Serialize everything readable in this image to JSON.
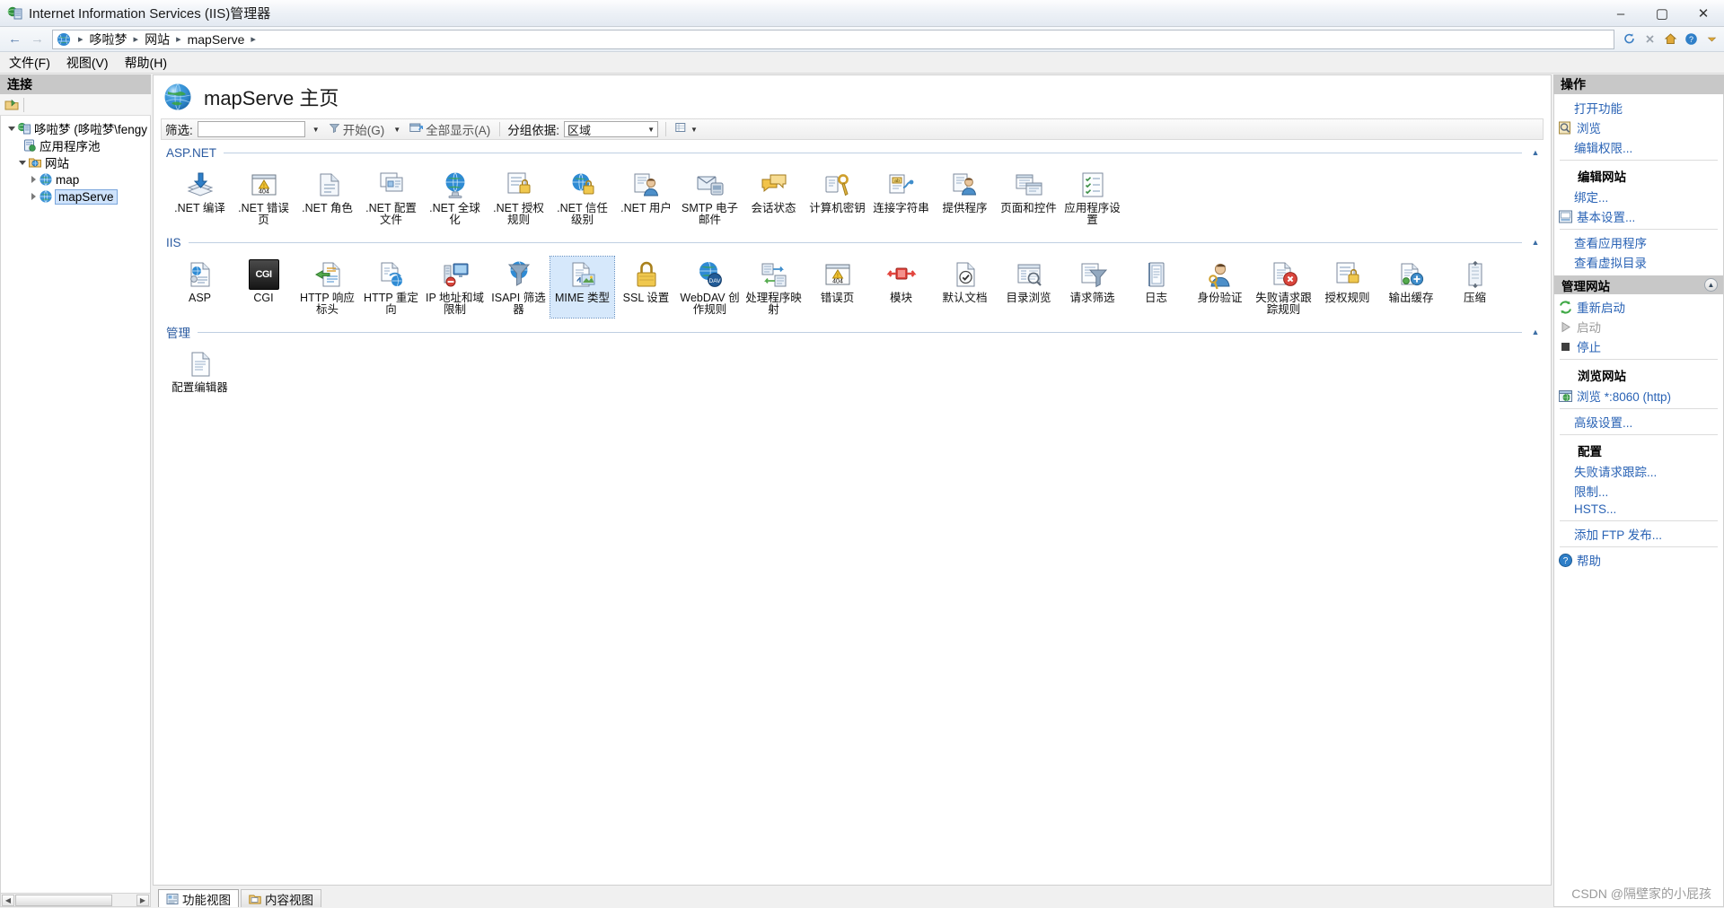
{
  "window": {
    "title": "Internet Information Services (IIS)管理器",
    "minimize": "–",
    "maximize": "▢",
    "close": "✕"
  },
  "address": {
    "back": "←",
    "forward": "→",
    "crumbs": [
      "哆啦梦",
      "网站",
      "mapServe"
    ],
    "separator": "▸",
    "trailing_separator": "▸"
  },
  "menu": {
    "items": [
      "文件(F)",
      "视图(V)",
      "帮助(H)"
    ]
  },
  "connections": {
    "header": "连接",
    "tree": [
      {
        "label": "哆啦梦 (哆啦梦\\fengy",
        "icon": "server-icon",
        "depth": 0,
        "expander": "expanded",
        "selected": false
      },
      {
        "label": "应用程序池",
        "icon": "app-pool-icon",
        "depth": 1,
        "expander": "none",
        "selected": false
      },
      {
        "label": "网站",
        "icon": "sites-folder-icon",
        "depth": 1,
        "expander": "expanded",
        "selected": false
      },
      {
        "label": "map",
        "icon": "site-globe-icon",
        "depth": 2,
        "expander": "collapsed",
        "selected": false
      },
      {
        "label": "mapServe",
        "icon": "site-globe-icon",
        "depth": 2,
        "expander": "collapsed",
        "selected": true
      }
    ]
  },
  "page": {
    "title": "mapServe 主页",
    "filter": {
      "label": "筛选:",
      "value": "",
      "placeholder": "",
      "go_label": "开始(G)",
      "show_all_label": "全部显示(A)",
      "group_by_label": "分组依据:",
      "group_by_value": "区域"
    },
    "sections": [
      {
        "name": "ASP.NET",
        "items": [
          {
            "label": ".NET 编译",
            "icon": "net-compile-icon"
          },
          {
            "label": ".NET 错误页",
            "icon": "error-404-icon"
          },
          {
            "label": ".NET 角色",
            "icon": "net-roles-icon"
          },
          {
            "label": ".NET 配置文件",
            "icon": "net-profile-icon"
          },
          {
            "label": ".NET 全球化",
            "icon": "globe-icon"
          },
          {
            "label": ".NET 授权规则",
            "icon": "auth-rules-icon"
          },
          {
            "label": ".NET 信任级别",
            "icon": "trust-levels-icon"
          },
          {
            "label": ".NET 用户",
            "icon": "net-users-icon"
          },
          {
            "label": "SMTP 电子邮件",
            "icon": "smtp-email-icon"
          },
          {
            "label": "会话状态",
            "icon": "session-state-icon"
          },
          {
            "label": "计算机密钥",
            "icon": "machine-key-icon"
          },
          {
            "label": "连接字符串",
            "icon": "connection-strings-icon"
          },
          {
            "label": "提供程序",
            "icon": "providers-icon"
          },
          {
            "label": "页面和控件",
            "icon": "pages-controls-icon"
          },
          {
            "label": "应用程序设置",
            "icon": "app-settings-icon"
          }
        ]
      },
      {
        "name": "IIS",
        "items": [
          {
            "label": "ASP",
            "icon": "asp-icon"
          },
          {
            "label": "CGI",
            "icon": "cgi-icon"
          },
          {
            "label": "HTTP 响应标头",
            "icon": "http-response-headers-icon"
          },
          {
            "label": "HTTP 重定向",
            "icon": "http-redirect-icon"
          },
          {
            "label": "IP 地址和域限制",
            "icon": "ip-restrictions-icon"
          },
          {
            "label": "ISAPI 筛选器",
            "icon": "isapi-filters-icon"
          },
          {
            "label": "MIME 类型",
            "icon": "mime-types-icon",
            "selected": true
          },
          {
            "label": "SSL 设置",
            "icon": "ssl-settings-icon"
          },
          {
            "label": "WebDAV 创作规则",
            "icon": "webdav-icon"
          },
          {
            "label": "处理程序映射",
            "icon": "handler-mappings-icon"
          },
          {
            "label": "错误页",
            "icon": "error-pages-icon"
          },
          {
            "label": "模块",
            "icon": "modules-icon"
          },
          {
            "label": "默认文档",
            "icon": "default-document-icon"
          },
          {
            "label": "目录浏览",
            "icon": "directory-browsing-icon"
          },
          {
            "label": "请求筛选",
            "icon": "request-filtering-icon"
          },
          {
            "label": "日志",
            "icon": "logging-icon"
          },
          {
            "label": "身份验证",
            "icon": "authentication-icon"
          },
          {
            "label": "失败请求跟踪规则",
            "icon": "failed-request-tracing-icon"
          },
          {
            "label": "授权规则",
            "icon": "authorization-rules-icon"
          },
          {
            "label": "输出缓存",
            "icon": "output-caching-icon"
          },
          {
            "label": "压缩",
            "icon": "compression-icon"
          }
        ]
      },
      {
        "name": "管理",
        "items": [
          {
            "label": "配置编辑器",
            "icon": "configuration-editor-icon"
          }
        ]
      }
    ],
    "view_tabs": [
      {
        "label": "功能视图",
        "icon": "features-view-icon",
        "active": true
      },
      {
        "label": "内容视图",
        "icon": "content-view-icon",
        "active": false
      }
    ]
  },
  "actions": {
    "header": "操作",
    "groups": [
      {
        "type": "plain",
        "items": [
          {
            "label": "打开功能",
            "icon": "none",
            "disabled": false,
            "indent": true
          },
          {
            "label": "浏览",
            "icon": "browse-icon",
            "disabled": false
          },
          {
            "label": "编辑权限...",
            "icon": "none",
            "disabled": false,
            "indent": true
          }
        ]
      },
      {
        "type": "sub",
        "title": "编辑网站",
        "items": [
          {
            "label": "绑定...",
            "icon": "none",
            "disabled": false,
            "indent": true
          },
          {
            "label": "基本设置...",
            "icon": "basic-settings-icon",
            "disabled": false
          }
        ]
      },
      {
        "type": "plain",
        "items": [
          {
            "label": "查看应用程序",
            "icon": "none",
            "disabled": false,
            "indent": true
          },
          {
            "label": "查看虚拟目录",
            "icon": "none",
            "disabled": false,
            "indent": true
          }
        ]
      },
      {
        "type": "header",
        "title": "管理网站",
        "collapse_icon": "chevron-up-icon",
        "items": [
          {
            "label": "重新启动",
            "icon": "restart-icon",
            "disabled": false
          },
          {
            "label": "启动",
            "icon": "start-icon",
            "disabled": true
          },
          {
            "label": "停止",
            "icon": "stop-icon",
            "disabled": false
          }
        ]
      },
      {
        "type": "sub",
        "title": "浏览网站",
        "items": [
          {
            "label": "浏览 *:8060 (http)",
            "icon": "browse-site-icon",
            "disabled": false
          }
        ]
      },
      {
        "type": "plain",
        "items": [
          {
            "label": "高级设置...",
            "icon": "none",
            "disabled": false,
            "indent": true
          }
        ]
      },
      {
        "type": "sub",
        "title": "配置",
        "items": [
          {
            "label": "失败请求跟踪...",
            "icon": "none",
            "disabled": false,
            "indent": true
          },
          {
            "label": "限制...",
            "icon": "none",
            "disabled": false,
            "indent": true
          },
          {
            "label": "HSTS...",
            "icon": "none",
            "disabled": false,
            "indent": true
          }
        ]
      },
      {
        "type": "plain",
        "items": [
          {
            "label": "添加 FTP 发布...",
            "icon": "none",
            "disabled": false,
            "indent": true
          }
        ]
      },
      {
        "type": "plain",
        "items": [
          {
            "label": "帮助",
            "icon": "help-icon",
            "disabled": false
          }
        ]
      }
    ]
  },
  "watermark": "CSDN @隔壁家的小屁孩"
}
